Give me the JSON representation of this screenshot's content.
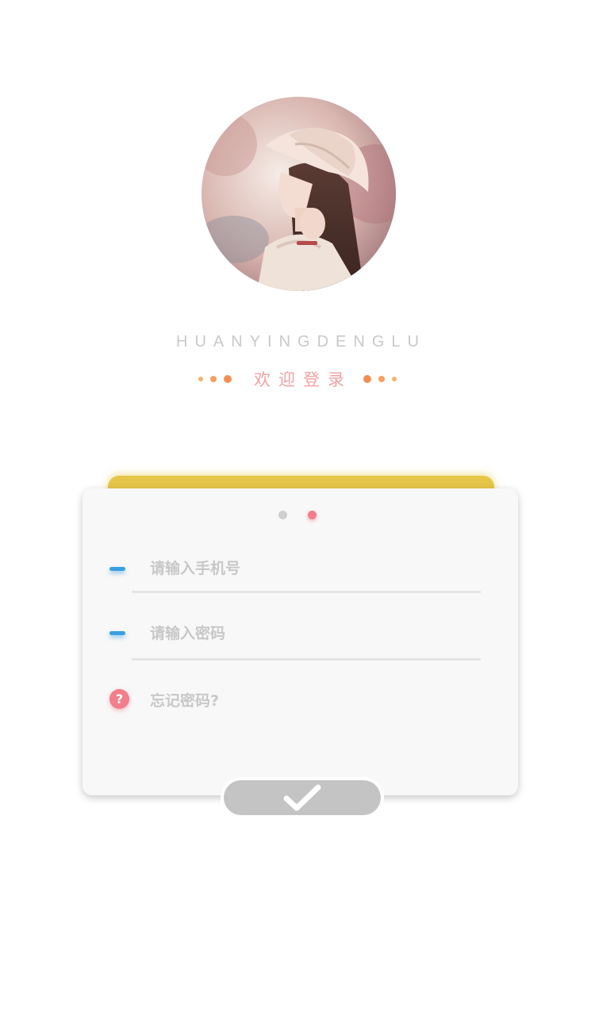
{
  "header": {
    "subtitle_en": "HUANYINGDENGLU",
    "welcome": "欢迎登录"
  },
  "pager": {
    "pages": 2,
    "active_index": 1
  },
  "form": {
    "phone_placeholder": "请输入手机号",
    "password_placeholder": "请输入密码",
    "forgot_label": "忘记密码?",
    "forgot_icon_glyph": "?"
  },
  "colors": {
    "accent_pink": "#f17e8a",
    "accent_blue": "#3a9fe0",
    "accent_orange": "#f39a5a",
    "tab_yellow": "#e6c648",
    "submit_gray": "#c4c4c4"
  },
  "icons": {
    "submit": "checkmark-icon",
    "forgot": "question-icon",
    "field": "dash-icon"
  }
}
